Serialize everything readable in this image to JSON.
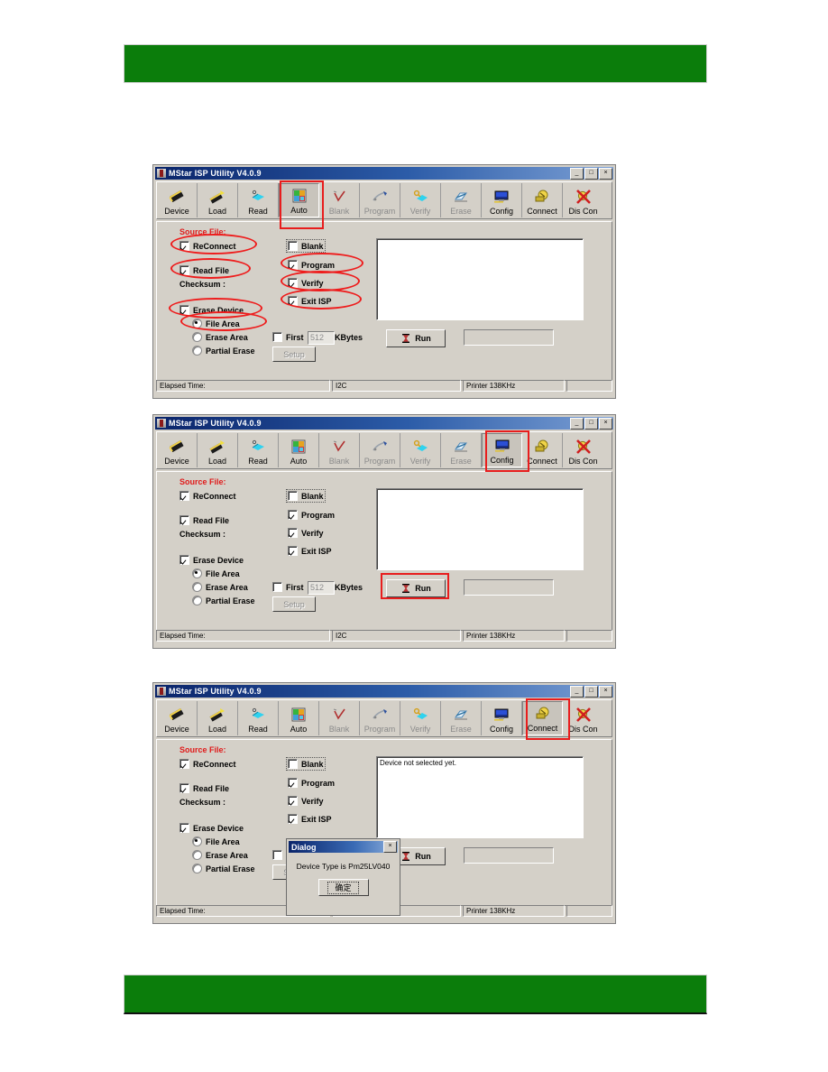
{
  "page": {
    "header_bar_color": "#0b7d0b",
    "footer_bar_color": "#0b7d0b",
    "highlight_color": "#ee1c1c"
  },
  "app": {
    "title": "MStar ISP Utility V4.0.9",
    "window_buttons": {
      "minimize": "_",
      "maximize": "□",
      "close": "×"
    },
    "toolbar": [
      {
        "label": "Device",
        "icon": "chip-icon"
      },
      {
        "label": "Load",
        "icon": "chip-load-icon"
      },
      {
        "label": "Read",
        "icon": "read-diamond-icon"
      },
      {
        "label": "Auto",
        "icon": "auto-colorblocks-icon"
      },
      {
        "label": "Blank",
        "icon": "blank-check-icon"
      },
      {
        "label": "Program",
        "icon": "program-pencil-icon"
      },
      {
        "label": "Verify",
        "icon": "verify-diamond-icon"
      },
      {
        "label": "Erase",
        "icon": "erase-icon"
      },
      {
        "label": "Config",
        "icon": "config-monitor-icon"
      },
      {
        "label": "Connect",
        "icon": "connect-plug-icon"
      },
      {
        "label": "Dis Con",
        "icon": "disconnect-icon"
      }
    ],
    "source_file_label": "Source File:",
    "left_options": {
      "reconnect": "ReConnect",
      "read_file": "Read File",
      "checksum": "Checksum :",
      "erase_device": "Erase Device",
      "file_area": "File Area",
      "erase_area": "Erase Area",
      "partial_erase": "Partial Erase",
      "setup": "Setup"
    },
    "right_options": {
      "blank": "Blank",
      "program": "Program",
      "verify": "Verify",
      "exit_isp": "Exit ISP"
    },
    "first_option": {
      "label": "First",
      "value": "512",
      "unit": "KBytes"
    },
    "run_button": "Run",
    "status": {
      "elapsed": "Elapsed Time:",
      "bus": "I2C",
      "printer": "Printer  138KHz",
      "extra": ""
    }
  },
  "window1": {
    "highlighted_toolbar_button": "Auto",
    "circled_items": [
      "ReConnect",
      "Read File",
      "Erase Device",
      "File Area",
      "Program",
      "Verify",
      "Exit ISP"
    ],
    "log_text": ""
  },
  "window2": {
    "highlighted_toolbar_button": "Config",
    "highlighted_control": "Run",
    "log_text": ""
  },
  "window3": {
    "highlighted_toolbar_button": "Connect",
    "log_text": "Device not selected yet.",
    "dialog": {
      "title": "Dialog",
      "close_label": "×",
      "message": "Device Type is Pm25LV040",
      "ok_label": "确定"
    }
  }
}
